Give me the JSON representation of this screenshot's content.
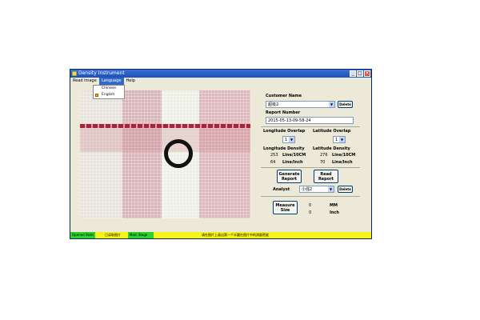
{
  "window": {
    "title": "Density Instrument"
  },
  "menu": {
    "items": [
      "Read Image",
      "Language",
      "Help"
    ],
    "language_options": [
      "Chinese",
      "English"
    ],
    "selected_language": "English"
  },
  "panel": {
    "customer_name_label": "Customer Name",
    "customer_name_value": "超级2",
    "delete_label": "Delete",
    "report_number_label": "Report Number",
    "report_number_value": "2015-05-13-09-58-24",
    "longitude_overlap_label": "Longitude Overlap",
    "latitude_overlap_label": "Latitude Overlap",
    "longitude_overlap_value": "1",
    "latitude_overlap_value": "1",
    "longitude_density_label": "Longitude Density",
    "latitude_density_label": "Latitude Density",
    "lon_10cm_value": "253",
    "lon_10cm_unit": "Line/10CM",
    "lat_10cm_value": "276",
    "lat_10cm_unit": "Line/10CM",
    "lon_inch_value": "64",
    "lon_inch_unit": "Line/Inch",
    "lat_inch_value": "70",
    "lat_inch_unit": "Line/Inch",
    "generate_report_label": "Generate Report",
    "read_report_label": "Read Report",
    "analyst_label": "Analyst",
    "analyst_value": "小强2",
    "measure_size_label": "Measure Size",
    "measure_mm_value": "0",
    "measure_mm_unit": "MM",
    "measure_inch_value": "0",
    "measure_inch_unit": "Inch"
  },
  "status": {
    "s1": "Opened Stats",
    "s2": "已读取图片",
    "s3": "Main Stage",
    "s4": "请在图片上画出第一个半圆在图片中的测量密度"
  },
  "colors": {
    "green": "#2fd12f",
    "yellow": "#f4f41a",
    "titlebar": "#1d4fb8"
  }
}
